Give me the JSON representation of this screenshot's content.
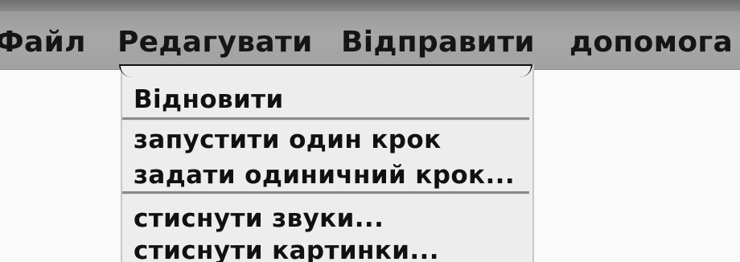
{
  "menubar": {
    "items": [
      {
        "label": "Файл"
      },
      {
        "label": "Редагувати"
      },
      {
        "label": "Відправити"
      },
      {
        "label": "допомога"
      }
    ]
  },
  "edit_menu": {
    "items": [
      {
        "label": "Відновити"
      },
      {
        "label": "запустити один крок"
      },
      {
        "label": "задати одиничний крок..."
      },
      {
        "label": "стиснути звуки..."
      },
      {
        "label": "стиснути картинки..."
      }
    ]
  }
}
